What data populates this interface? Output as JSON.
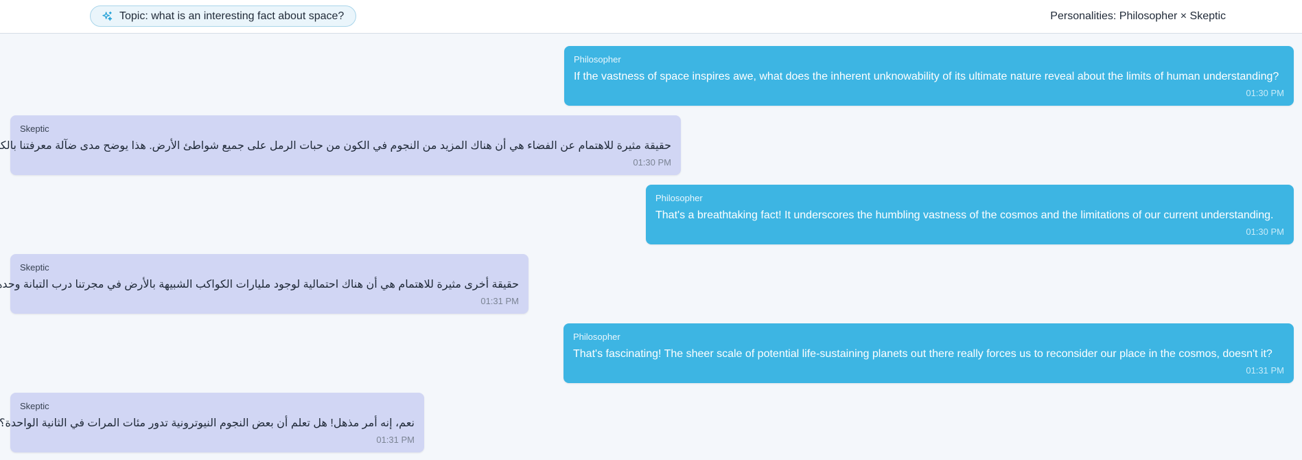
{
  "header": {
    "topic_icon": "sparkles-icon",
    "topic": "Topic: what is an interesting fact about space?",
    "personalities": "Personalities: Philosopher × Skeptic"
  },
  "colors": {
    "philosopher_bubble": "#3db5e3",
    "skeptic_bubble": "#d1d6f4",
    "background": "#f4f7fb"
  },
  "messages": [
    {
      "sender": "Philosopher",
      "text": "If the vastness of space inspires awe, what does the inherent unknowability of its ultimate nature reveal about the limits of human understanding?",
      "time": "01:30 PM"
    },
    {
      "sender": "Skeptic",
      "text": "حقيقة مثيرة للاهتمام عن الفضاء هي أن هناك المزيد من النجوم في الكون من حبات الرمل على جميع شواطئ الأرض.  هذا يوضح مدى ضآلة معرفتنا بالكون.",
      "time": "01:30 PM"
    },
    {
      "sender": "Philosopher",
      "text": "That's a breathtaking fact!  It underscores the humbling vastness of the cosmos and the limitations of our current understanding.",
      "time": "01:30 PM"
    },
    {
      "sender": "Skeptic",
      "text": "حقيقة أخرى مثيرة للاهتمام هي أن هناك احتمالية لوجود مليارات الكواكب الشبيهة بالأرض في مجرتنا درب التبانة وحدها.",
      "time": "01:31 PM"
    },
    {
      "sender": "Philosopher",
      "text": "That's fascinating!  The sheer scale of potential life-sustaining planets out there really forces us to reconsider our place in the cosmos, doesn't it?",
      "time": "01:31 PM"
    },
    {
      "sender": "Skeptic",
      "text": "نعم، إنه أمر مذهل!  هل تعلم أن بعض النجوم النيوترونية تدور مئات المرات في الثانية الواحدة؟",
      "time": "01:31 PM"
    }
  ]
}
